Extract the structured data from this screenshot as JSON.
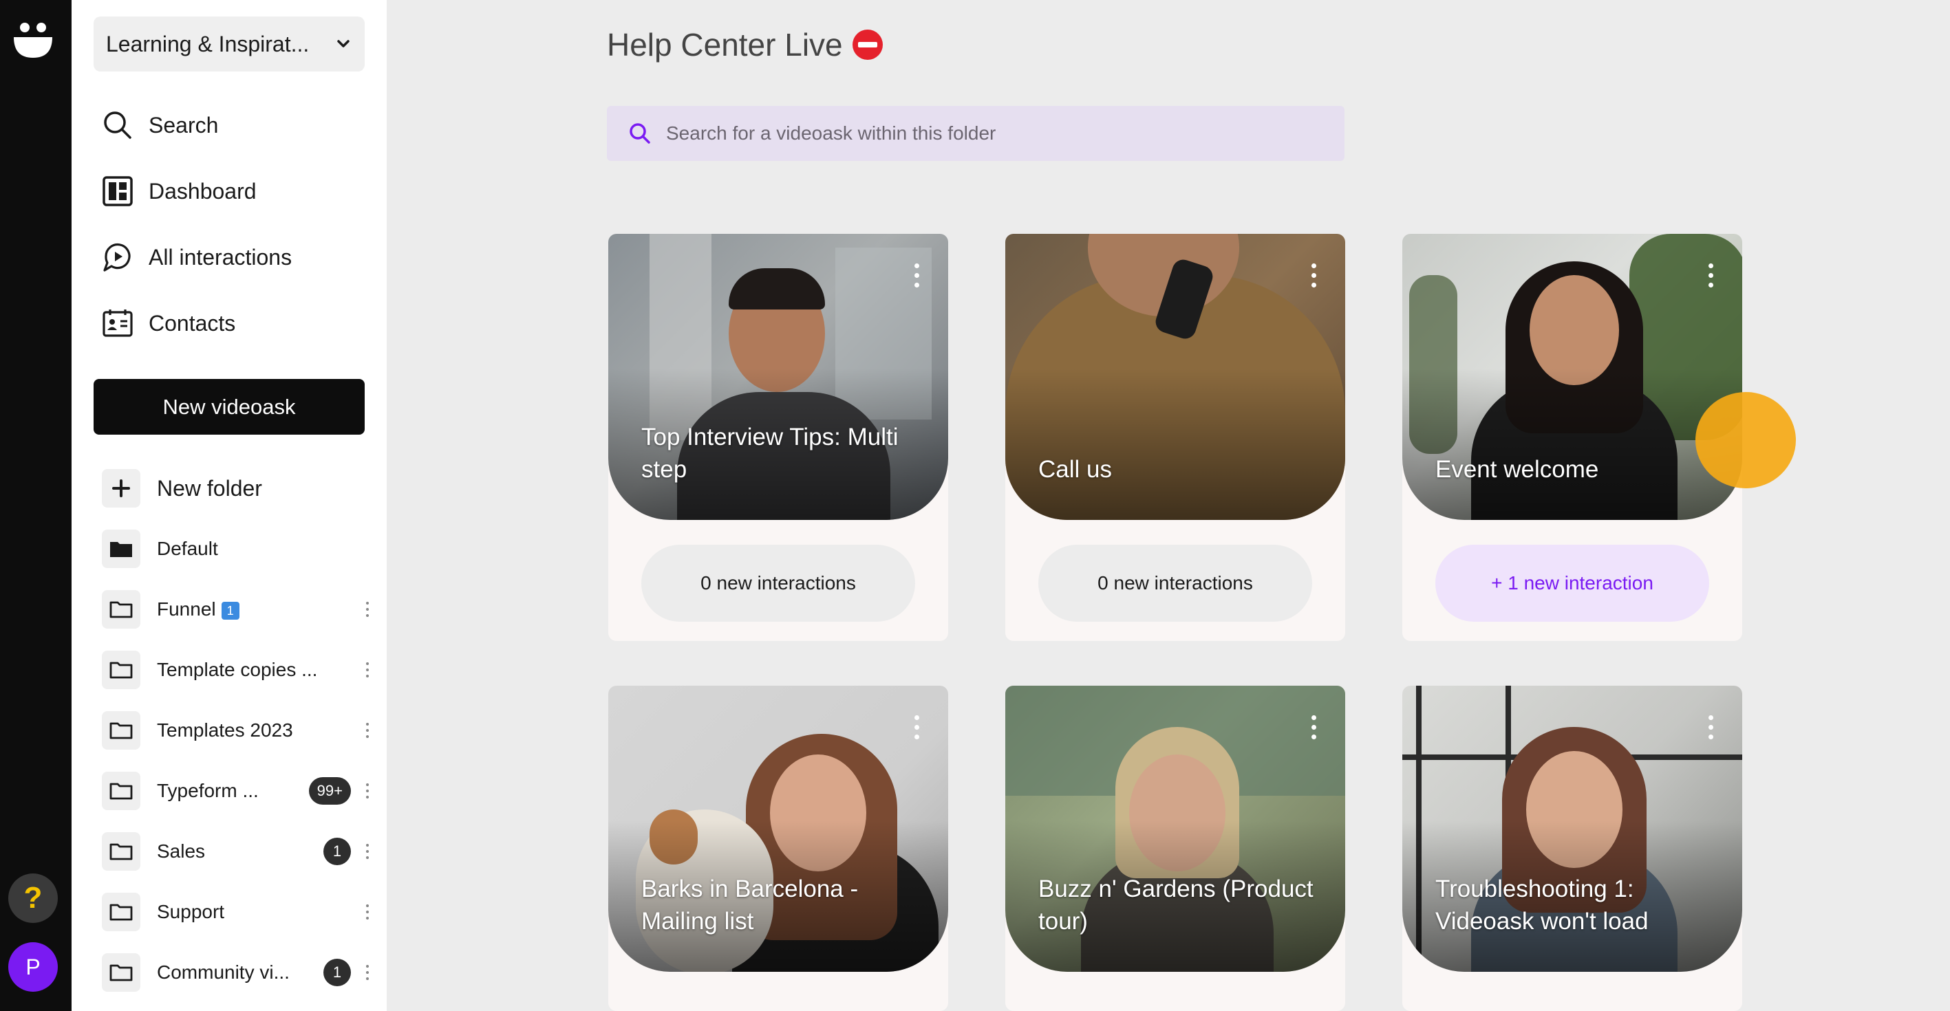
{
  "rail": {
    "help_label": "?",
    "avatar_initial": "P"
  },
  "sidebar": {
    "workspace": "Learning & Inspirat...",
    "nav": [
      {
        "label": "Search",
        "icon": "search-icon"
      },
      {
        "label": "Dashboard",
        "icon": "dashboard-icon"
      },
      {
        "label": "All interactions",
        "icon": "interactions-icon"
      },
      {
        "label": "Contacts",
        "icon": "contacts-icon"
      }
    ],
    "new_videoask_label": "New videoask",
    "new_folder_label": "New folder",
    "folders": [
      {
        "name": "Default",
        "badge": "",
        "icon": "folder-filled-icon"
      },
      {
        "name": "Funnel",
        "emoji": "1",
        "badge": "",
        "icon": "folder-icon"
      },
      {
        "name": "Template copies ...",
        "badge": "",
        "icon": "folder-icon"
      },
      {
        "name": "Templates 2023",
        "badge": "",
        "icon": "folder-icon"
      },
      {
        "name": "Typeform ...",
        "badge": "99+",
        "icon": "folder-icon"
      },
      {
        "name": "Sales",
        "badge": "1",
        "icon": "folder-icon"
      },
      {
        "name": "Support",
        "badge": "",
        "icon": "folder-icon"
      },
      {
        "name": "Community vi...",
        "badge": "1",
        "icon": "folder-icon"
      }
    ]
  },
  "main": {
    "title": "Help Center Live",
    "search_placeholder": "Search for a videoask within this folder",
    "cards": [
      {
        "title": "Top Interview Tips: Multi step",
        "interactions": "0 new interactions",
        "has_new": false
      },
      {
        "title": "Call us",
        "interactions": "0 new interactions",
        "has_new": false
      },
      {
        "title": "Event welcome",
        "interactions": "+ 1 new interaction",
        "has_new": true
      },
      {
        "title": "Barks in Barcelona - Mailing list",
        "interactions": "",
        "has_new": false
      },
      {
        "title": "Buzz n' Gardens (Product tour)",
        "interactions": "",
        "has_new": false
      },
      {
        "title": "Troubleshooting 1: Videoask won't load",
        "interactions": "",
        "has_new": false
      }
    ]
  },
  "colors": {
    "accent": "#7a1bf2",
    "rail": "#0d0d0d",
    "help_yellow": "#f5c400",
    "badge": "#2e2e2e",
    "orange_blob": "#f5a916"
  }
}
